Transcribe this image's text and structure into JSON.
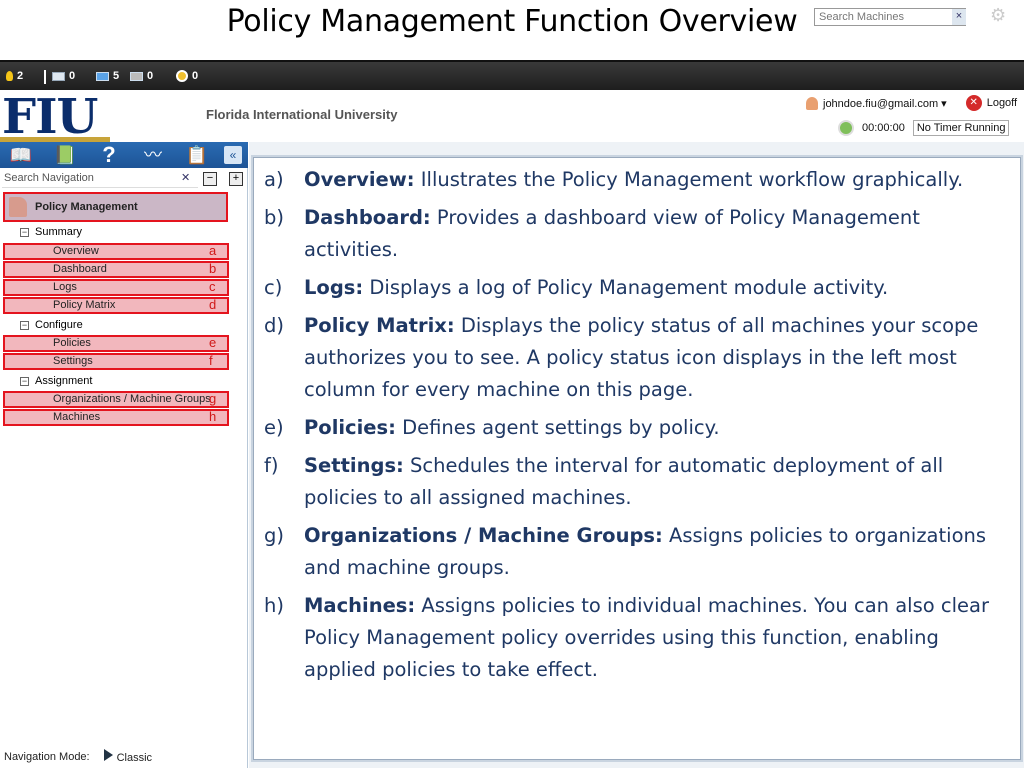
{
  "slide": {
    "title": "Policy Management Function Overview"
  },
  "statusbar": {
    "alerts": "2",
    "messages": "0",
    "online": "5",
    "offline": "0",
    "timers": "0",
    "search_placeholder": "Search Machines",
    "search_clear": "×"
  },
  "header": {
    "logo": "FIU",
    "university": "Florida International University",
    "user": "johndoe.fiu@gmail.com ▾",
    "logoff": "Logoff",
    "timer": "00:00:00",
    "timer_status": "No Timer Running"
  },
  "nav": {
    "search_placeholder": "Search Navigation",
    "module": "Policy Management",
    "folders": [
      "Summary",
      "Configure",
      "Assignment"
    ],
    "items": [
      {
        "label": "Overview",
        "tag": "a"
      },
      {
        "label": "Dashboard",
        "tag": "b"
      },
      {
        "label": "Logs",
        "tag": "c"
      },
      {
        "label": "Policy Matrix",
        "tag": "d"
      },
      {
        "label": "Policies",
        "tag": "e"
      },
      {
        "label": "Settings",
        "tag": "f"
      },
      {
        "label": "Organizations / Machine Groups",
        "tag": "g"
      },
      {
        "label": "Machines",
        "tag": "h"
      }
    ],
    "footer_label": "Navigation Mode:",
    "footer_mode": "Classic"
  },
  "definitions": [
    {
      "letter": "a)",
      "term": "Overview:",
      "text": " Illustrates the Policy Management workflow graphically."
    },
    {
      "letter": "b)",
      "term": "Dashboard:",
      "text": " Provides a dashboard view of Policy Management activities."
    },
    {
      "letter": "c)",
      "term": "Logs:",
      "text": " Displays a log of Policy Management module activity."
    },
    {
      "letter": "d)",
      "term": "Policy Matrix:",
      "text": " Displays the policy status of all machines your scope authorizes you to see. A policy status icon displays in the left most column for every machine on this page."
    },
    {
      "letter": "e)",
      "term": "Policies:",
      "text": " Defines agent settings by policy."
    },
    {
      "letter": "f)",
      "term": "Settings:",
      "text": " Schedules the interval for automatic deployment of all policies to all assigned machines."
    },
    {
      "letter": "g)",
      "term": "Organizations / Machine Groups:",
      "text": " Assigns policies to organizations and machine groups."
    },
    {
      "letter": "h)",
      "term": "Machines:",
      "text": " Assigns policies to individual machines. You can also clear Policy Management policy overrides using this function, enabling applied policies to take effect."
    }
  ]
}
